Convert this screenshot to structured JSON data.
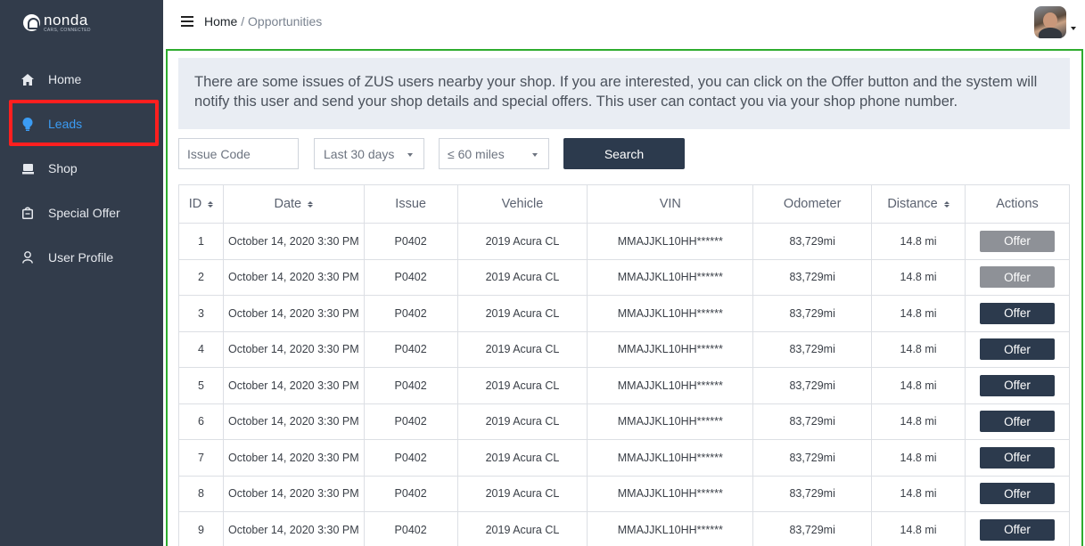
{
  "brand": {
    "name": "nonda",
    "tagline": "CARS, CONNECTED"
  },
  "sidebar": {
    "items": [
      {
        "label": "Home",
        "icon": "home-icon",
        "active": false
      },
      {
        "label": "Leads",
        "icon": "lightbulb-icon",
        "active": true
      },
      {
        "label": "Shop",
        "icon": "shop-icon",
        "active": false
      },
      {
        "label": "Special Offer",
        "icon": "offer-tag-icon",
        "active": false
      },
      {
        "label": "User Profile",
        "icon": "user-icon",
        "active": false
      }
    ]
  },
  "header": {
    "breadcrumb": {
      "home": "Home",
      "separator": " / ",
      "current": "Opportunities"
    }
  },
  "notice": {
    "text": "There are some issues of ZUS users nearby your shop. If you are interested, you can click on the Offer button and the system will notify this user and send your shop details and special offers. This user can contact you via your shop phone number."
  },
  "filters": {
    "issue_code_placeholder": "Issue Code",
    "date_range": "Last 30 days",
    "distance": "≤ 60 miles",
    "search_label": "Search"
  },
  "table": {
    "headers": [
      "ID",
      "Date",
      "Issue",
      "Vehicle",
      "VIN",
      "Odometer",
      "Distance",
      "Actions"
    ],
    "rows": [
      {
        "id": "1",
        "date": "October 14, 2020 3:30 PM",
        "issue": "P0402",
        "vehicle": "2019 Acura CL",
        "vin": "MMAJJKL10HH******",
        "odometer": "83,729mi",
        "distance": "14.8 mi",
        "action": "Offer",
        "action_enabled": false
      },
      {
        "id": "2",
        "date": "October 14, 2020 3:30 PM",
        "issue": "P0402",
        "vehicle": "2019 Acura CL",
        "vin": "MMAJJKL10HH******",
        "odometer": "83,729mi",
        "distance": "14.8 mi",
        "action": "Offer",
        "action_enabled": false
      },
      {
        "id": "3",
        "date": "October 14, 2020 3:30 PM",
        "issue": "P0402",
        "vehicle": "2019 Acura CL",
        "vin": "MMAJJKL10HH******",
        "odometer": "83,729mi",
        "distance": "14.8 mi",
        "action": "Offer",
        "action_enabled": true
      },
      {
        "id": "4",
        "date": "October 14, 2020 3:30 PM",
        "issue": "P0402",
        "vehicle": "2019 Acura CL",
        "vin": "MMAJJKL10HH******",
        "odometer": "83,729mi",
        "distance": "14.8 mi",
        "action": "Offer",
        "action_enabled": true
      },
      {
        "id": "5",
        "date": "October 14, 2020 3:30 PM",
        "issue": "P0402",
        "vehicle": "2019 Acura CL",
        "vin": "MMAJJKL10HH******",
        "odometer": "83,729mi",
        "distance": "14.8 mi",
        "action": "Offer",
        "action_enabled": true
      },
      {
        "id": "6",
        "date": "October 14, 2020 3:30 PM",
        "issue": "P0402",
        "vehicle": "2019 Acura CL",
        "vin": "MMAJJKL10HH******",
        "odometer": "83,729mi",
        "distance": "14.8 mi",
        "action": "Offer",
        "action_enabled": true
      },
      {
        "id": "7",
        "date": "October 14, 2020 3:30 PM",
        "issue": "P0402",
        "vehicle": "2019 Acura CL",
        "vin": "MMAJJKL10HH******",
        "odometer": "83,729mi",
        "distance": "14.8 mi",
        "action": "Offer",
        "action_enabled": true
      },
      {
        "id": "8",
        "date": "October 14, 2020 3:30 PM",
        "issue": "P0402",
        "vehicle": "2019 Acura CL",
        "vin": "MMAJJKL10HH******",
        "odometer": "83,729mi",
        "distance": "14.8 mi",
        "action": "Offer",
        "action_enabled": true
      },
      {
        "id": "9",
        "date": "October 14, 2020 3:30 PM",
        "issue": "P0402",
        "vehicle": "2019 Acura CL",
        "vin": "MMAJJKL10HH******",
        "odometer": "83,729mi",
        "distance": "14.8 mi",
        "action": "Offer",
        "action_enabled": true
      }
    ]
  },
  "colors": {
    "sidebar_bg": "#323c4b",
    "active_nav": "#3b9cf4",
    "highlight_border": "#ff1f1f",
    "panel_border": "#2eac2e",
    "primary_button": "#2c3a4d",
    "disabled_button": "#8e9197",
    "notice_bg": "#e9edf3"
  }
}
